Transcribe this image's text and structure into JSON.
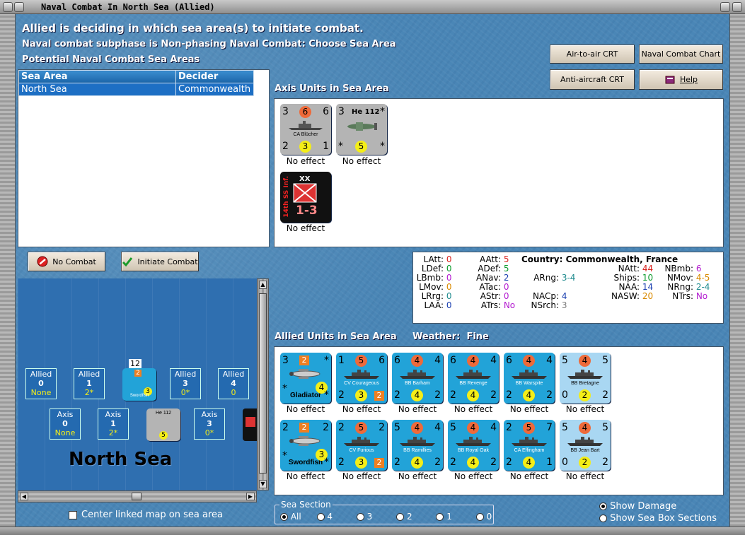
{
  "window": {
    "title": "Naval Combat In North Sea (Allied)"
  },
  "header": {
    "line1": "Allied is deciding in which sea area(s) to initiate combat.",
    "line2": "Naval combat subphase is Non-phasing Naval Combat: Choose Sea Area",
    "line3": "Potential Naval Combat Sea Areas"
  },
  "buttons": {
    "air_to_air": "Air-to-air CRT",
    "naval_chart": "Naval Combat Chart",
    "anti_aircraft": "Anti-aircraft CRT",
    "help": "Help",
    "no_combat": "No Combat",
    "initiate": "Initiate Combat"
  },
  "sea_table": {
    "headers": [
      "Sea Area",
      "Decider"
    ],
    "rows": [
      [
        "North Sea",
        "Commonwealth"
      ]
    ]
  },
  "axis": {
    "title": "Axis Units in Sea Area",
    "units": [
      {
        "name": "CA Blücher",
        "tl": "3",
        "top": "6",
        "tr": "6",
        "bl": "2",
        "bot": "3",
        "br": "1",
        "status": "No effect"
      },
      {
        "name": "He 112",
        "tl": "3",
        "tr": "*",
        "bl": "*",
        "bot": "5",
        "br": "*",
        "status": "No effect"
      },
      {
        "name": "14th SS Inf.",
        "corps": "XX",
        "value": "1-3",
        "status": "No effect"
      }
    ]
  },
  "stats": {
    "country_label": "Country:",
    "country": "Commonwealth, France",
    "col1": [
      [
        "LAtt:",
        "0"
      ],
      [
        "LDef:",
        "0"
      ],
      [
        "LBmb:",
        "0"
      ],
      [
        "LMov:",
        "0"
      ],
      [
        "LRrg:",
        "0"
      ],
      [
        "LAA:",
        "0"
      ]
    ],
    "col2": [
      [
        "AAtt:",
        "5"
      ],
      [
        "ADef:",
        "5"
      ],
      [
        "ANav:",
        "2"
      ],
      [
        "ATac:",
        "0"
      ],
      [
        "AStr:",
        "0"
      ],
      [
        "ATrs:",
        "No"
      ]
    ],
    "col3": [
      [
        "ARng:",
        "3-4"
      ],
      [
        "NACp:",
        "4"
      ],
      [
        "NSrch:",
        "3"
      ]
    ],
    "col4": [
      [
        "NAtt:",
        "44"
      ],
      [
        "Ships:",
        "10"
      ],
      [
        "NAA:",
        "14"
      ],
      [
        "NASW:",
        "20"
      ]
    ],
    "col5": [
      [
        "NBmb:",
        "6"
      ],
      [
        "NMov:",
        "4-5"
      ],
      [
        "NRng:",
        "2-4"
      ],
      [
        "NTrs:",
        "No"
      ]
    ]
  },
  "allied": {
    "title": "Allied Units in Sea Area",
    "weather_label": "Weather:",
    "weather": "Fine",
    "units": [
      {
        "name": "Gladiator",
        "tl": "3",
        "top": "2",
        "tr": "*",
        "bl": "*",
        "bot": "4",
        "br": "*",
        "status": "No effect"
      },
      {
        "name": "CV Courageous",
        "tl": "1",
        "top": "5",
        "tr": "6",
        "bl": "2",
        "bot": "3",
        "br": "2",
        "status": "No effect"
      },
      {
        "name": "BB Barham",
        "tl": "6",
        "top": "4",
        "tr": "4",
        "bl": "2",
        "bot": "4",
        "br": "2",
        "status": "No effect"
      },
      {
        "name": "BB Revenge",
        "tl": "6",
        "top": "4",
        "tr": "4",
        "bl": "2",
        "bot": "4",
        "br": "2",
        "status": "No effect"
      },
      {
        "name": "BB Warspite",
        "tl": "6",
        "top": "4",
        "tr": "4",
        "bl": "2",
        "bot": "4",
        "br": "2",
        "status": "No effect"
      },
      {
        "name": "BB Bretagne",
        "tl": "5",
        "top": "4",
        "tr": "5",
        "bl": "0",
        "bot": "2",
        "br": "2",
        "status": "No effect"
      },
      {
        "name": "Swordfish",
        "tl": "2",
        "top": "2",
        "tr": "2",
        "bl": "*",
        "bot": "3",
        "br": "*",
        "status": "No effect"
      },
      {
        "name": "CV Furious",
        "tl": "2",
        "top": "5",
        "tr": "2",
        "bl": "2",
        "bot": "3",
        "br": "2",
        "status": "No effect"
      },
      {
        "name": "BB Ramillies",
        "tl": "5",
        "top": "4",
        "tr": "4",
        "bl": "2",
        "bot": "4",
        "br": "2",
        "status": "No effect"
      },
      {
        "name": "BB Royal Oak",
        "tl": "5",
        "top": "4",
        "tr": "4",
        "bl": "2",
        "bot": "4",
        "br": "2",
        "status": "No effect"
      },
      {
        "name": "CA Effingham",
        "tl": "2",
        "top": "5",
        "tr": "7",
        "bl": "2",
        "bot": "4",
        "br": "1",
        "status": "No effect"
      },
      {
        "name": "BB Jean Bart",
        "tl": "5",
        "top": "4",
        "tr": "5",
        "bl": "0",
        "bot": "2",
        "br": "2",
        "status": "No effect"
      }
    ]
  },
  "map": {
    "name": "North Sea",
    "stack_count": "12",
    "allied_boxes": [
      {
        "label": "Allied",
        "num": "0",
        "val": "None"
      },
      {
        "label": "Allied",
        "num": "1",
        "val": "2*"
      },
      {
        "label": "Allied",
        "num": "3",
        "val": "0*"
      },
      {
        "label": "Allied",
        "num": "4",
        "val": "0"
      }
    ],
    "axis_boxes": [
      {
        "label": "Axis",
        "num": "0",
        "val": "None"
      },
      {
        "label": "Axis",
        "num": "1",
        "val": "2*"
      },
      {
        "label": "Axis",
        "num": "3",
        "val": "0*"
      }
    ],
    "map_unit1": "Swordfish",
    "map_unit2": "He 112"
  },
  "footer": {
    "center_map": "Center linked map on sea area",
    "sea_section": "Sea Section",
    "sections": [
      "All",
      "4",
      "3",
      "2",
      "1",
      "0"
    ],
    "show_damage": "Show Damage",
    "show_sections": "Show Sea Box Sections"
  }
}
